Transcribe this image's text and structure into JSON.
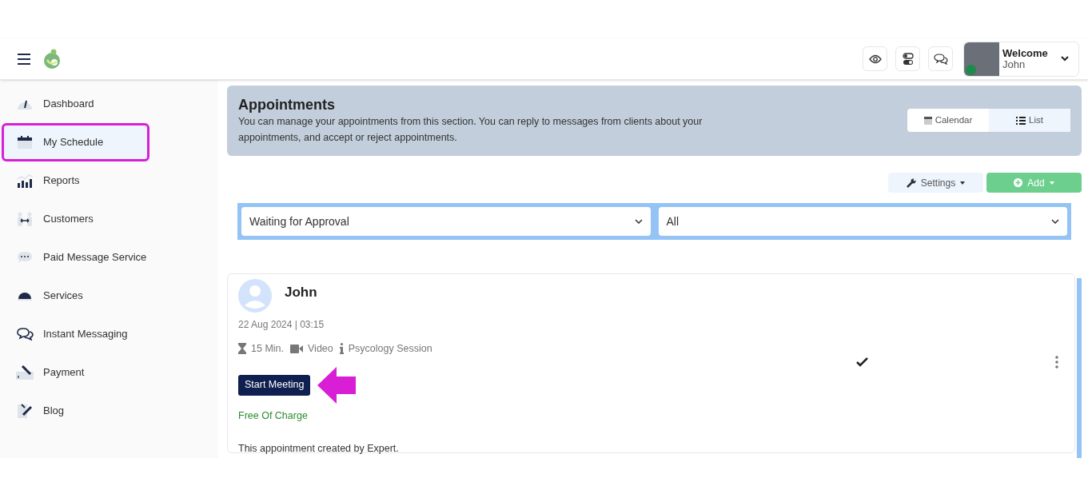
{
  "header": {
    "user": {
      "greeting": "Welcome",
      "name": "John",
      "online": true
    }
  },
  "sidebar": {
    "items": [
      {
        "label": "Dashboard",
        "selected": false
      },
      {
        "label": "My Schedule",
        "selected": true
      },
      {
        "label": "Reports",
        "selected": false
      },
      {
        "label": "Customers",
        "selected": false
      },
      {
        "label": "Paid Message Service",
        "selected": false
      },
      {
        "label": "Services",
        "selected": false
      },
      {
        "label": "Instant Messaging",
        "selected": false
      },
      {
        "label": "Payment",
        "selected": false
      },
      {
        "label": "Blog",
        "selected": false
      }
    ]
  },
  "page": {
    "title": "Appointments",
    "description": "You can manage your appointments from this section. You can reply to messages from clients about your appointments, and accept or reject appointments.",
    "view_tabs": [
      {
        "label": "Calendar",
        "selected": false
      },
      {
        "label": "List",
        "selected": true
      }
    ],
    "buttons": [
      {
        "label": "Settings",
        "kind": "settings"
      },
      {
        "label": "Add",
        "kind": "add"
      }
    ],
    "filters": [
      {
        "value": "Waiting for Approval"
      },
      {
        "value": "All"
      }
    ]
  },
  "appointment": {
    "name": "John",
    "datetime": "22 Aug 2024 | 03:15",
    "duration": "15 Min.",
    "type": "Video",
    "service": "Psycology Session",
    "action": "Start Meeting",
    "price": "Free Of Charge",
    "note": "This appointment created by Expert.",
    "approved": true
  }
}
